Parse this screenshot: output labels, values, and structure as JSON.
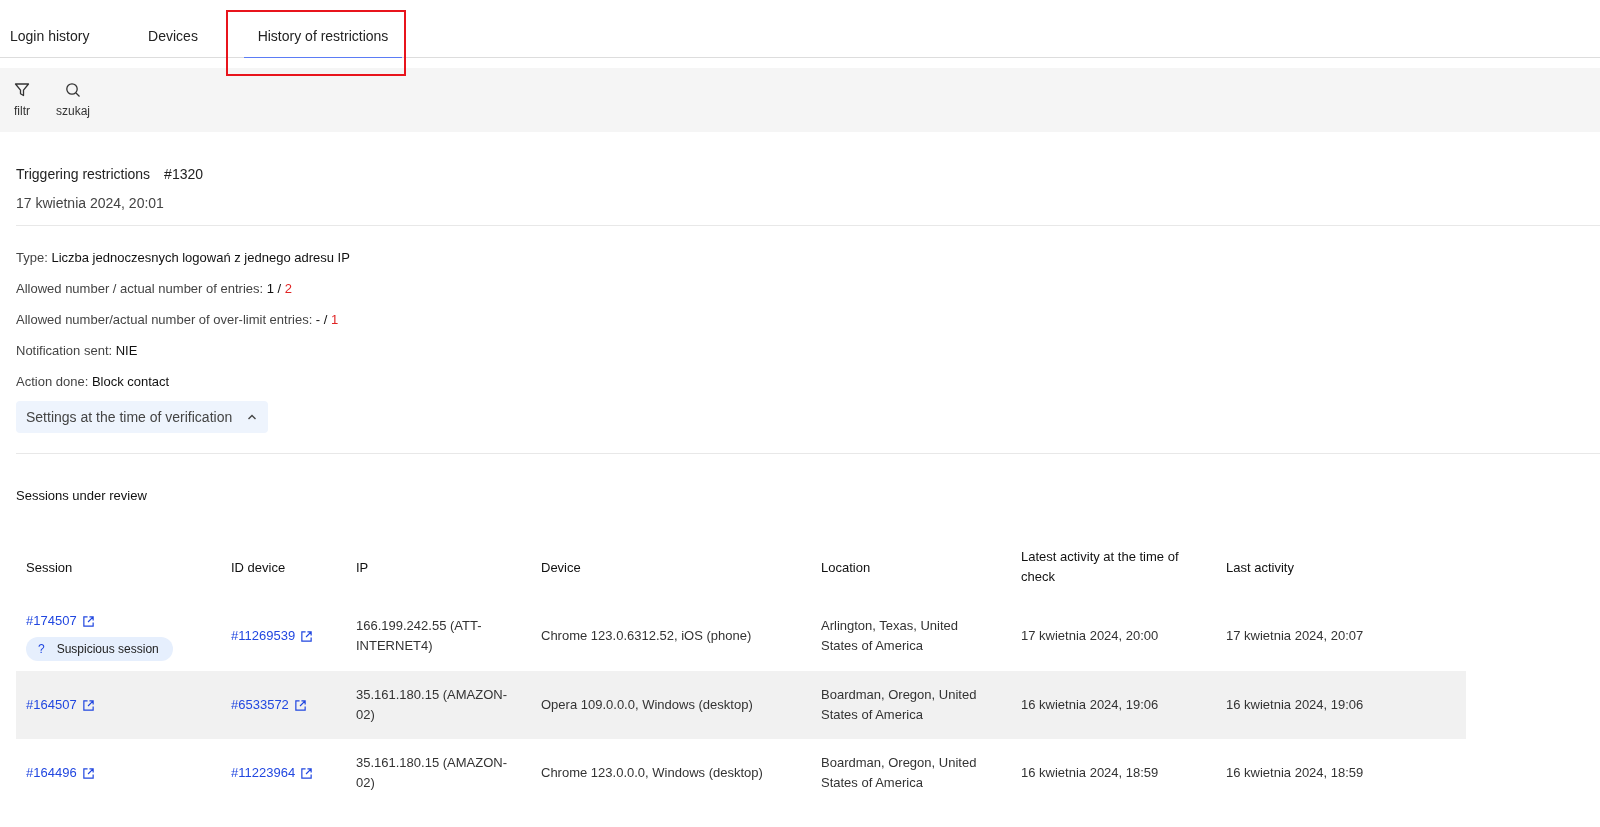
{
  "tabs": [
    {
      "label": "Login history",
      "selected": false,
      "annotated": false
    },
    {
      "label": "Devices",
      "selected": false,
      "annotated": false
    },
    {
      "label": "History of restrictions",
      "selected": true,
      "annotated": true
    }
  ],
  "toolbar": [
    {
      "kind": "filter",
      "label": "filtr"
    },
    {
      "kind": "search",
      "label": "szukaj"
    }
  ],
  "restriction": {
    "title": "Triggering restrictions",
    "number": "#1320",
    "date": "17 kwietnia 2024, 20:01"
  },
  "details": [
    {
      "label": "Type:",
      "value": "Liczba jednoczesnych logowań z jednego adresu IP"
    },
    {
      "label": "Allowed number / actual number of entries:",
      "value": "1 /",
      "alert": "2"
    },
    {
      "label": "Allowed number/actual number of over-limit entries:",
      "value": "- /",
      "alert": "1"
    },
    {
      "label": "Notification sent:",
      "value": "NIE"
    },
    {
      "label": "Action done:",
      "value": "Block contact"
    }
  ],
  "settings_toggle": {
    "label": "Settings at the time of verification",
    "expanded": true
  },
  "sessions": {
    "title": "Sessions under review",
    "columns": [
      "Session",
      "ID device",
      "IP",
      "Device",
      "Location",
      "Latest activity at the time of check",
      "Last activity"
    ],
    "rows": [
      {
        "session": "#174507",
        "badge_icon": "?",
        "badge": "Suspicious session",
        "device_id": "#11269539",
        "ip": "166.199.242.55 (ATT-INTERNET4)",
        "device": "Chrome 123.0.6312.52, iOS (phone)",
        "location": "Arlington, Texas, United States of America",
        "latest": "17 kwietnia 2024, 20:00",
        "last": "17 kwietnia 2024, 20:07",
        "highlighted": false
      },
      {
        "session": "#164507",
        "device_id": "#6533572",
        "ip": "35.161.180.15 (AMAZON-02)",
        "device": "Opera 109.0.0.0, Windows (desktop)",
        "location": "Boardman, Oregon, United States of America",
        "latest": "16 kwietnia 2024, 19:06",
        "last": "16 kwietnia 2024, 19:06",
        "highlighted": true
      },
      {
        "session": "#164496",
        "device_id": "#11223964",
        "ip": "35.161.180.15 (AMAZON-02)",
        "device": "Chrome 123.0.0.0, Windows (desktop)",
        "location": "Boardman, Oregon, United States of America",
        "latest": "16 kwietnia 2024, 18:59",
        "last": "16 kwietnia 2024, 18:59",
        "highlighted": false
      }
    ]
  }
}
